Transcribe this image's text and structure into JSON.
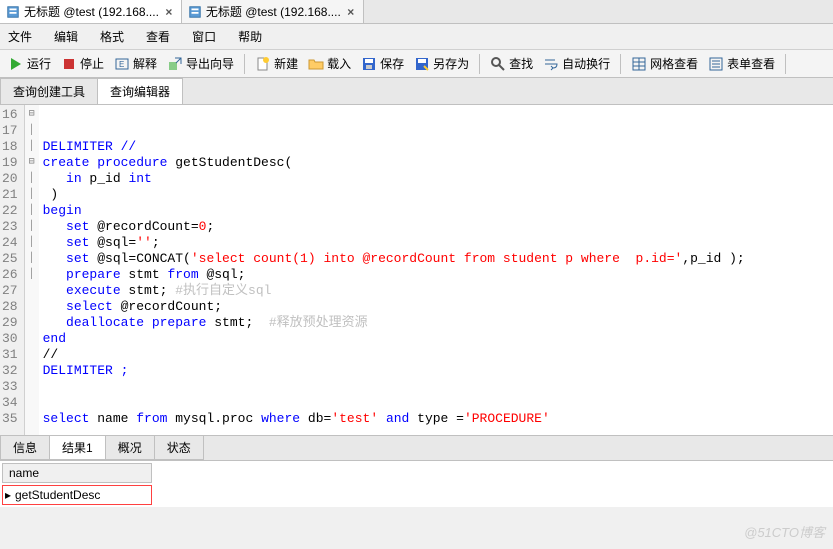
{
  "file_tabs": [
    {
      "label": "无标题 @test (192.168....",
      "active": true
    },
    {
      "label": "无标题 @test (192.168....",
      "active": false
    }
  ],
  "menu": {
    "file": "文件",
    "edit": "编辑",
    "format": "格式",
    "view": "查看",
    "window": "窗口",
    "help": "帮助"
  },
  "toolbar": {
    "run": "运行",
    "stop": "停止",
    "explain": "解释",
    "export": "导出向导",
    "new": "新建",
    "load": "载入",
    "save": "保存",
    "saveas": "另存为",
    "find": "查找",
    "autowrap": "自动换行",
    "gridview": "网格查看",
    "formview": "表单查看"
  },
  "sub_tabs": {
    "builder": "查询创建工具",
    "editor": "查询编辑器"
  },
  "code": {
    "lines": [
      {
        "n": 16,
        "raw": ""
      },
      {
        "n": 17,
        "raw": ""
      },
      {
        "n": 18,
        "segs": [
          {
            "t": "DELIMITER //",
            "c": "kw"
          }
        ]
      },
      {
        "n": 19,
        "fold": "⊟",
        "segs": [
          {
            "t": "create procedure",
            "c": "kw"
          },
          {
            "t": " getStudentDesc("
          }
        ]
      },
      {
        "n": 20,
        "bar": true,
        "segs": [
          {
            "t": "   "
          },
          {
            "t": "in",
            "c": "kw"
          },
          {
            "t": " p_id "
          },
          {
            "t": "int",
            "c": "kw"
          }
        ]
      },
      {
        "n": 21,
        "bar": true,
        "segs": [
          {
            "t": " )"
          }
        ]
      },
      {
        "n": 22,
        "fold": "⊟",
        "segs": [
          {
            "t": "begin",
            "c": "kw"
          }
        ]
      },
      {
        "n": 23,
        "bar": true,
        "segs": [
          {
            "t": "   "
          },
          {
            "t": "set",
            "c": "kw"
          },
          {
            "t": " @recordCount="
          },
          {
            "t": "0",
            "c": "num"
          },
          {
            "t": ";"
          }
        ]
      },
      {
        "n": 24,
        "bar": true,
        "segs": [
          {
            "t": "   "
          },
          {
            "t": "set",
            "c": "kw"
          },
          {
            "t": " @sql="
          },
          {
            "t": "''",
            "c": "str"
          },
          {
            "t": ";"
          }
        ]
      },
      {
        "n": 25,
        "bar": true,
        "segs": [
          {
            "t": "   "
          },
          {
            "t": "set",
            "c": "kw"
          },
          {
            "t": " @sql=CONCAT("
          },
          {
            "t": "'select count(1) into @recordCount from student p where  p.id='",
            "c": "str"
          },
          {
            "t": ",p_id );"
          }
        ]
      },
      {
        "n": 26,
        "bar": true,
        "segs": [
          {
            "t": "   "
          },
          {
            "t": "prepare",
            "c": "kw"
          },
          {
            "t": " stmt "
          },
          {
            "t": "from",
            "c": "kw"
          },
          {
            "t": " @sql;"
          }
        ]
      },
      {
        "n": 27,
        "bar": true,
        "segs": [
          {
            "t": "   "
          },
          {
            "t": "execute",
            "c": "kw"
          },
          {
            "t": " stmt; "
          },
          {
            "t": "#执行自定义sql",
            "c": "cmt"
          }
        ]
      },
      {
        "n": 28,
        "bar": true,
        "segs": [
          {
            "t": "   "
          },
          {
            "t": "select",
            "c": "kw"
          },
          {
            "t": " @recordCount;"
          }
        ]
      },
      {
        "n": 29,
        "bar": true,
        "segs": [
          {
            "t": "   "
          },
          {
            "t": "deallocate prepare",
            "c": "kw"
          },
          {
            "t": " stmt;  "
          },
          {
            "t": "#释放预处理资源",
            "c": "cmt"
          }
        ]
      },
      {
        "n": 30,
        "segs": [
          {
            "t": "end",
            "c": "kw"
          }
        ]
      },
      {
        "n": 31,
        "segs": [
          {
            "t": "//"
          }
        ]
      },
      {
        "n": 32,
        "segs": [
          {
            "t": "DELIMITER ;",
            "c": "kw"
          }
        ]
      },
      {
        "n": 33,
        "raw": ""
      },
      {
        "n": 34,
        "raw": ""
      },
      {
        "n": 35,
        "segs": [
          {
            "t": "select",
            "c": "kw"
          },
          {
            "t": " name "
          },
          {
            "t": "from",
            "c": "kw"
          },
          {
            "t": " mysql.proc "
          },
          {
            "t": "where",
            "c": "kw"
          },
          {
            "t": " db="
          },
          {
            "t": "'test'",
            "c": "str"
          },
          {
            "t": " "
          },
          {
            "t": "and",
            "c": "kw"
          },
          {
            "t": " type ="
          },
          {
            "t": "'PROCEDURE'",
            "c": "str"
          }
        ]
      },
      {
        "n": "",
        "raw": ""
      }
    ]
  },
  "bottom_tabs": {
    "info": "信息",
    "result1": "结果1",
    "profile": "概况",
    "status": "状态"
  },
  "result": {
    "column": "name",
    "row1": "getStudentDesc"
  },
  "watermark": "@51CTO博客"
}
